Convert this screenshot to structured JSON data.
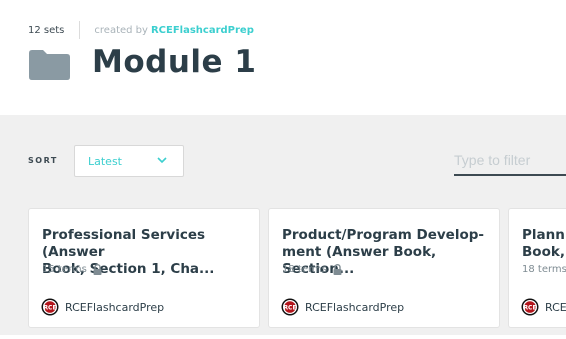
{
  "header": {
    "sets_count": "12 sets",
    "created_by_label": "created by",
    "creator": "RCEFlashcardPrep",
    "title": "Module 1"
  },
  "controls": {
    "sort_label": "SORT",
    "sort_value": "Latest",
    "filter_placeholder": "Type to filter"
  },
  "cards": [
    {
      "title": "Professional Services (Answer\nBook, Section 1, Cha...",
      "terms": "15 terms",
      "creator": "RCEFlashcardPrep"
    },
    {
      "title": "Product/Program Develop-\nment (Answer Book, Section...",
      "terms": "18 terms",
      "creator": "RCEFlashcardPrep"
    },
    {
      "title": "Plannin\nBook, S",
      "terms": "18 terms",
      "creator": "RCEF"
    }
  ],
  "colors": {
    "accent": "#3ccfcf",
    "folder": "#8a9aa3",
    "page_background": "#f0f0f0"
  },
  "icons": {
    "folder": "folder-icon",
    "chevron": "chevron-down-icon",
    "lock": "lock-icon",
    "avatar": "rce-logo-avatar"
  }
}
